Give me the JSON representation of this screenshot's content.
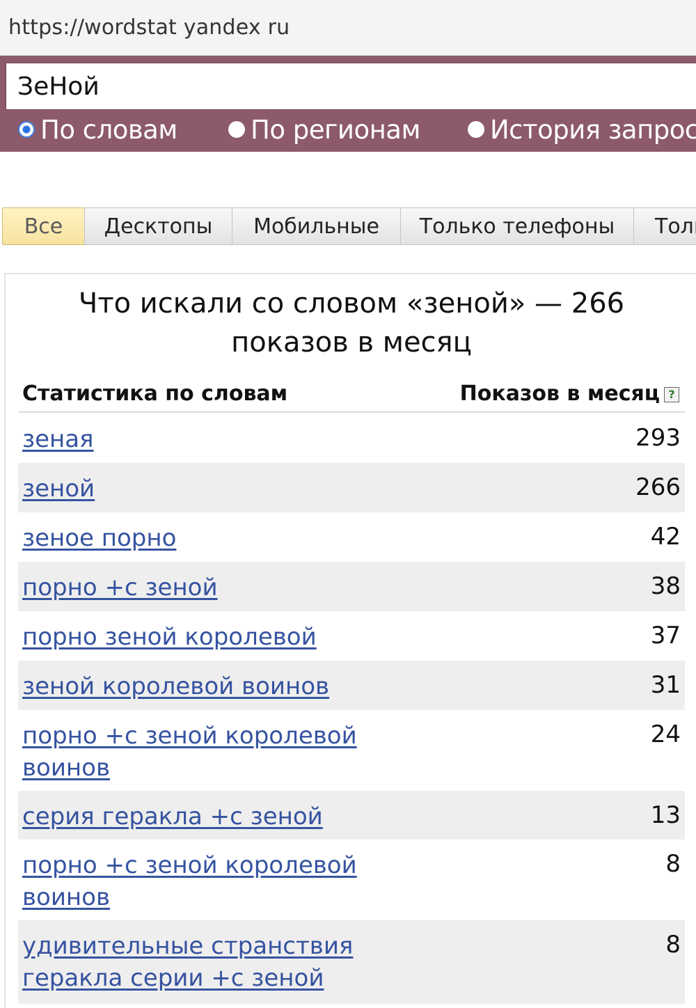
{
  "browser": {
    "url": "https://wordstat yandex ru"
  },
  "search": {
    "value": "ЗеНой",
    "modes": [
      {
        "label": "По словам",
        "checked": true
      },
      {
        "label": "По регионам",
        "checked": false
      },
      {
        "label": "История запрос",
        "checked": false
      }
    ]
  },
  "device_tabs": [
    {
      "label": "Все",
      "active": true
    },
    {
      "label": "Десктопы",
      "active": false
    },
    {
      "label": "Мобильные",
      "active": false
    },
    {
      "label": "Только телефоны",
      "active": false
    },
    {
      "label": "Толь",
      "active": false
    }
  ],
  "results": {
    "heading_line1": "Что искали со словом «зеной» — 266",
    "heading_line2": "показов в месяц",
    "col_words": "Статистика по словам",
    "col_shows": "Показов в месяц",
    "help_glyph": "?",
    "rows": [
      {
        "phrase": "зеная",
        "count": "293"
      },
      {
        "phrase": "зеной",
        "count": "266"
      },
      {
        "phrase": "зеное порно",
        "count": "42"
      },
      {
        "phrase": "порно +с зеной",
        "count": "38"
      },
      {
        "phrase": "порно зеной королевой",
        "count": "37"
      },
      {
        "phrase": "зеной королевой воинов",
        "count": "31"
      },
      {
        "phrase": "порно +с зеной королевой воинов",
        "count": "24"
      },
      {
        "phrase": "серия геракла +с зеной",
        "count": "13"
      },
      {
        "phrase": "порно +с зеной королевой воинов",
        "count": "8"
      },
      {
        "phrase": "удивительные странствия геракла серии +с зеной",
        "count": "8"
      }
    ]
  },
  "colors": {
    "search_band": "#8c5a6c",
    "link": "#3553a0",
    "active_tab": "#f7e3a0",
    "row_shade": "#eeeeee"
  }
}
